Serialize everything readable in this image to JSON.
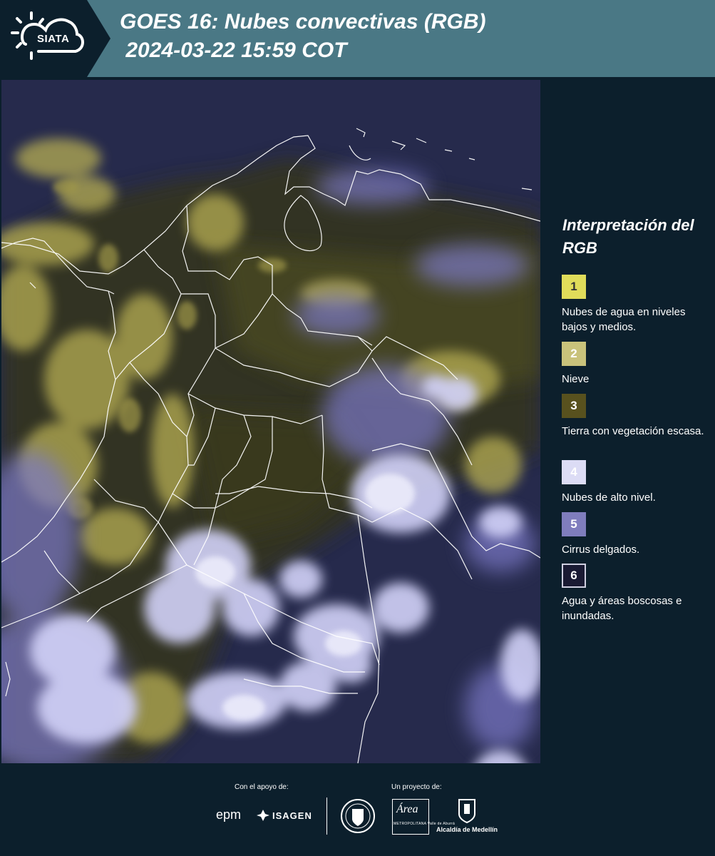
{
  "header": {
    "logo_text": "SIATA",
    "title_line1": "GOES 16: Nubes convectivas (RGB)",
    "title_line2": " 2024-03-22 15:59 COT",
    "background": "#4a7885"
  },
  "legend": {
    "title": "Interpretación del RGB",
    "items": [
      {
        "number": "1",
        "label": "Nubes de agua en niveles bajos y medios.",
        "color": "#e0dc5a"
      },
      {
        "number": "2",
        "label": "Nieve",
        "color": "#c9c27b"
      },
      {
        "number": "3",
        "label": "Tierra con vegetación escasa.",
        "color": "#58511e"
      },
      {
        "number": "4",
        "label": "Nubes de alto nivel.",
        "color": "#dcdcf5"
      },
      {
        "number": "5",
        "label": "Cirrus delgados.",
        "color": "#7f7dbd"
      },
      {
        "number": "6",
        "label": "Agua y áreas boscosas e inundadas.",
        "color": "#1a1a33"
      }
    ]
  },
  "footer": {
    "support_label": "Con el apoyo de:",
    "project_label": "Un proyecto de:",
    "sponsor1": "epm",
    "sponsor2": "ISAGEN",
    "partner1_name": "Área",
    "partner1_sub": "METROPOLITANA Valle de Aburrá",
    "partner2": "Alcaldía de Medellín"
  },
  "colors": {
    "background": "#0c1f2c",
    "map_base": "#262a4c",
    "low_cloud": "#c4bc58",
    "high_cloud": "#d6d6f8",
    "cirrus": "#8a88d8"
  }
}
